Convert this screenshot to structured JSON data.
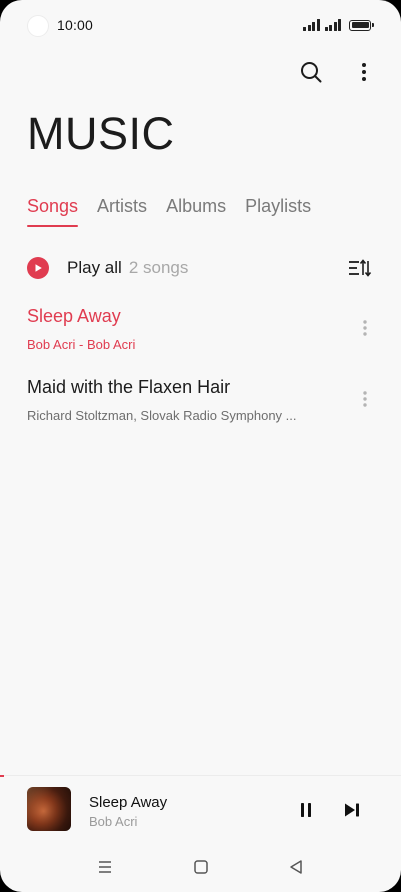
{
  "status_bar": {
    "time": "10:00"
  },
  "header": {
    "title": "MUSIC",
    "icons": [
      "search-icon",
      "more-vertical-icon"
    ]
  },
  "tabs": [
    {
      "label": "Songs",
      "active": true
    },
    {
      "label": "Artists",
      "active": false
    },
    {
      "label": "Albums",
      "active": false
    },
    {
      "label": "Playlists",
      "active": false
    }
  ],
  "play_all": {
    "label": "Play all",
    "count": "2 songs"
  },
  "songs": [
    {
      "title": "Sleep Away",
      "subtitle": "Bob Acri - Bob Acri",
      "playing": true
    },
    {
      "title": "Maid with the Flaxen Hair",
      "subtitle": "Richard Stoltzman, Slovak Radio Symphony ...",
      "playing": false
    }
  ],
  "now_playing": {
    "title": "Sleep Away",
    "artist": "Bob Acri",
    "progress_fraction": 0.01,
    "state": "playing"
  },
  "colors": {
    "accent": "#e03c50",
    "background": "#f8f8f8",
    "text_primary": "#1c1c1c",
    "text_secondary": "#7a7a7a"
  }
}
